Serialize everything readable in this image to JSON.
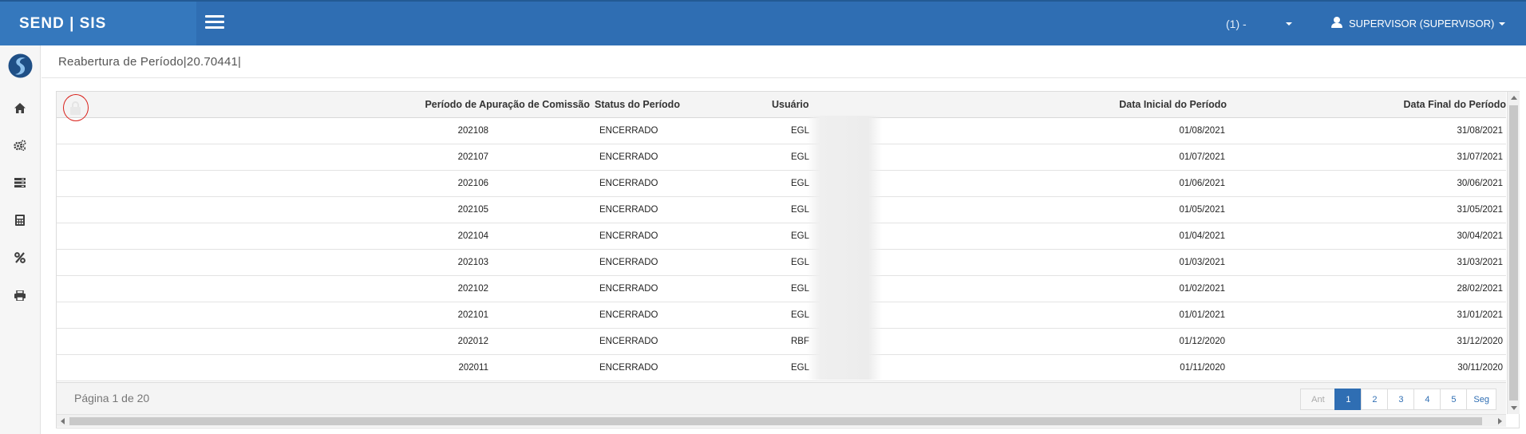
{
  "app": {
    "brand": "SEND | SIS",
    "company_selector": "(1) -",
    "user": "SUPERVISOR (SUPERVISOR)",
    "accent_color": "#2f6eb3",
    "lock_highlight_color": "#d9201a"
  },
  "sidebar": {
    "items": [
      {
        "name": "logo",
        "icon": "app-logo-icon"
      },
      {
        "name": "home",
        "icon": "home-icon"
      },
      {
        "name": "settings",
        "icon": "gears-icon"
      },
      {
        "name": "registrations",
        "icon": "list-icon"
      },
      {
        "name": "calculator",
        "icon": "calculator-icon"
      },
      {
        "name": "commission",
        "icon": "percent-icon"
      },
      {
        "name": "print",
        "icon": "print-icon"
      }
    ]
  },
  "page": {
    "title": "Reabertura de Período|20.70441|"
  },
  "table": {
    "columns": {
      "period": "Período de Apuração de Comissão",
      "status": "Status do Período",
      "user": "Usuário",
      "start": "Data Inicial do Período",
      "end": "Data Final do Período"
    },
    "rows": [
      {
        "period": "202108",
        "status": "ENCERRADO",
        "user": "EGL",
        "start": "01/08/2021",
        "end": "31/08/2021"
      },
      {
        "period": "202107",
        "status": "ENCERRADO",
        "user": "EGL",
        "start": "01/07/2021",
        "end": "31/07/2021"
      },
      {
        "period": "202106",
        "status": "ENCERRADO",
        "user": "EGL",
        "start": "01/06/2021",
        "end": "30/06/2021"
      },
      {
        "period": "202105",
        "status": "ENCERRADO",
        "user": "EGL",
        "start": "01/05/2021",
        "end": "31/05/2021"
      },
      {
        "period": "202104",
        "status": "ENCERRADO",
        "user": "EGL",
        "start": "01/04/2021",
        "end": "30/04/2021"
      },
      {
        "period": "202103",
        "status": "ENCERRADO",
        "user": "EGL",
        "start": "01/03/2021",
        "end": "31/03/2021"
      },
      {
        "period": "202102",
        "status": "ENCERRADO",
        "user": "EGL",
        "start": "01/02/2021",
        "end": "28/02/2021"
      },
      {
        "period": "202101",
        "status": "ENCERRADO",
        "user": "EGL",
        "start": "01/01/2021",
        "end": "31/01/2021"
      },
      {
        "period": "202012",
        "status": "ENCERRADO",
        "user": "RBF",
        "start": "01/12/2020",
        "end": "31/12/2020"
      },
      {
        "period": "202011",
        "status": "ENCERRADO",
        "user": "EGL",
        "start": "01/11/2020",
        "end": "30/11/2020"
      }
    ]
  },
  "footer": {
    "page_info": "Página 1 de 20",
    "pager": [
      "Ant",
      "1",
      "2",
      "3",
      "4",
      "5",
      "Seg"
    ],
    "current_page": "1"
  }
}
